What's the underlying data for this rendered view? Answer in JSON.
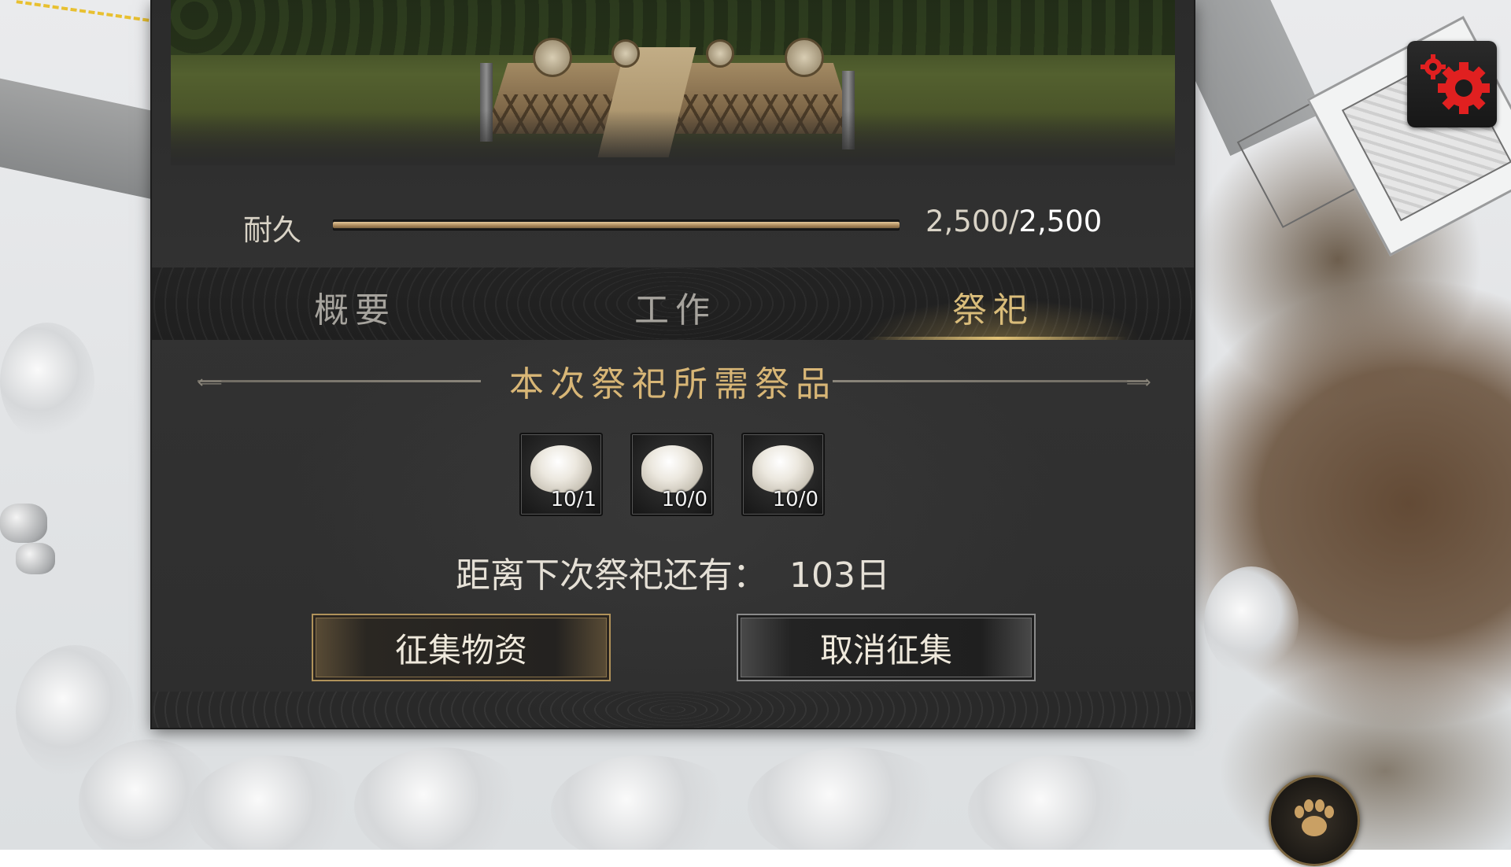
{
  "durability": {
    "label": "耐久",
    "current": "2,500",
    "separator": "/",
    "max": "2,500",
    "fill_fraction": 1.0
  },
  "tabs": [
    {
      "label": "概要",
      "active": false
    },
    {
      "label": "工作",
      "active": false
    },
    {
      "label": "祭祀",
      "active": true
    }
  ],
  "offerings": {
    "title": "本次祭祀所需祭品",
    "items": [
      {
        "icon": "rice-icon",
        "quantity": "10/1"
      },
      {
        "icon": "rice-icon",
        "quantity": "10/0"
      },
      {
        "icon": "rice-icon",
        "quantity": "10/0"
      }
    ]
  },
  "countdown": {
    "text": "距离下次祭祀还有：  103日"
  },
  "buttons": {
    "collect": "征集物资",
    "cancel": "取消征集"
  },
  "hud": {
    "settings_icon": "gear-icon",
    "beast_icon": "paw-icon"
  },
  "colors": {
    "accent_gold": "#d9bc7a",
    "gear_red": "#e02020"
  }
}
